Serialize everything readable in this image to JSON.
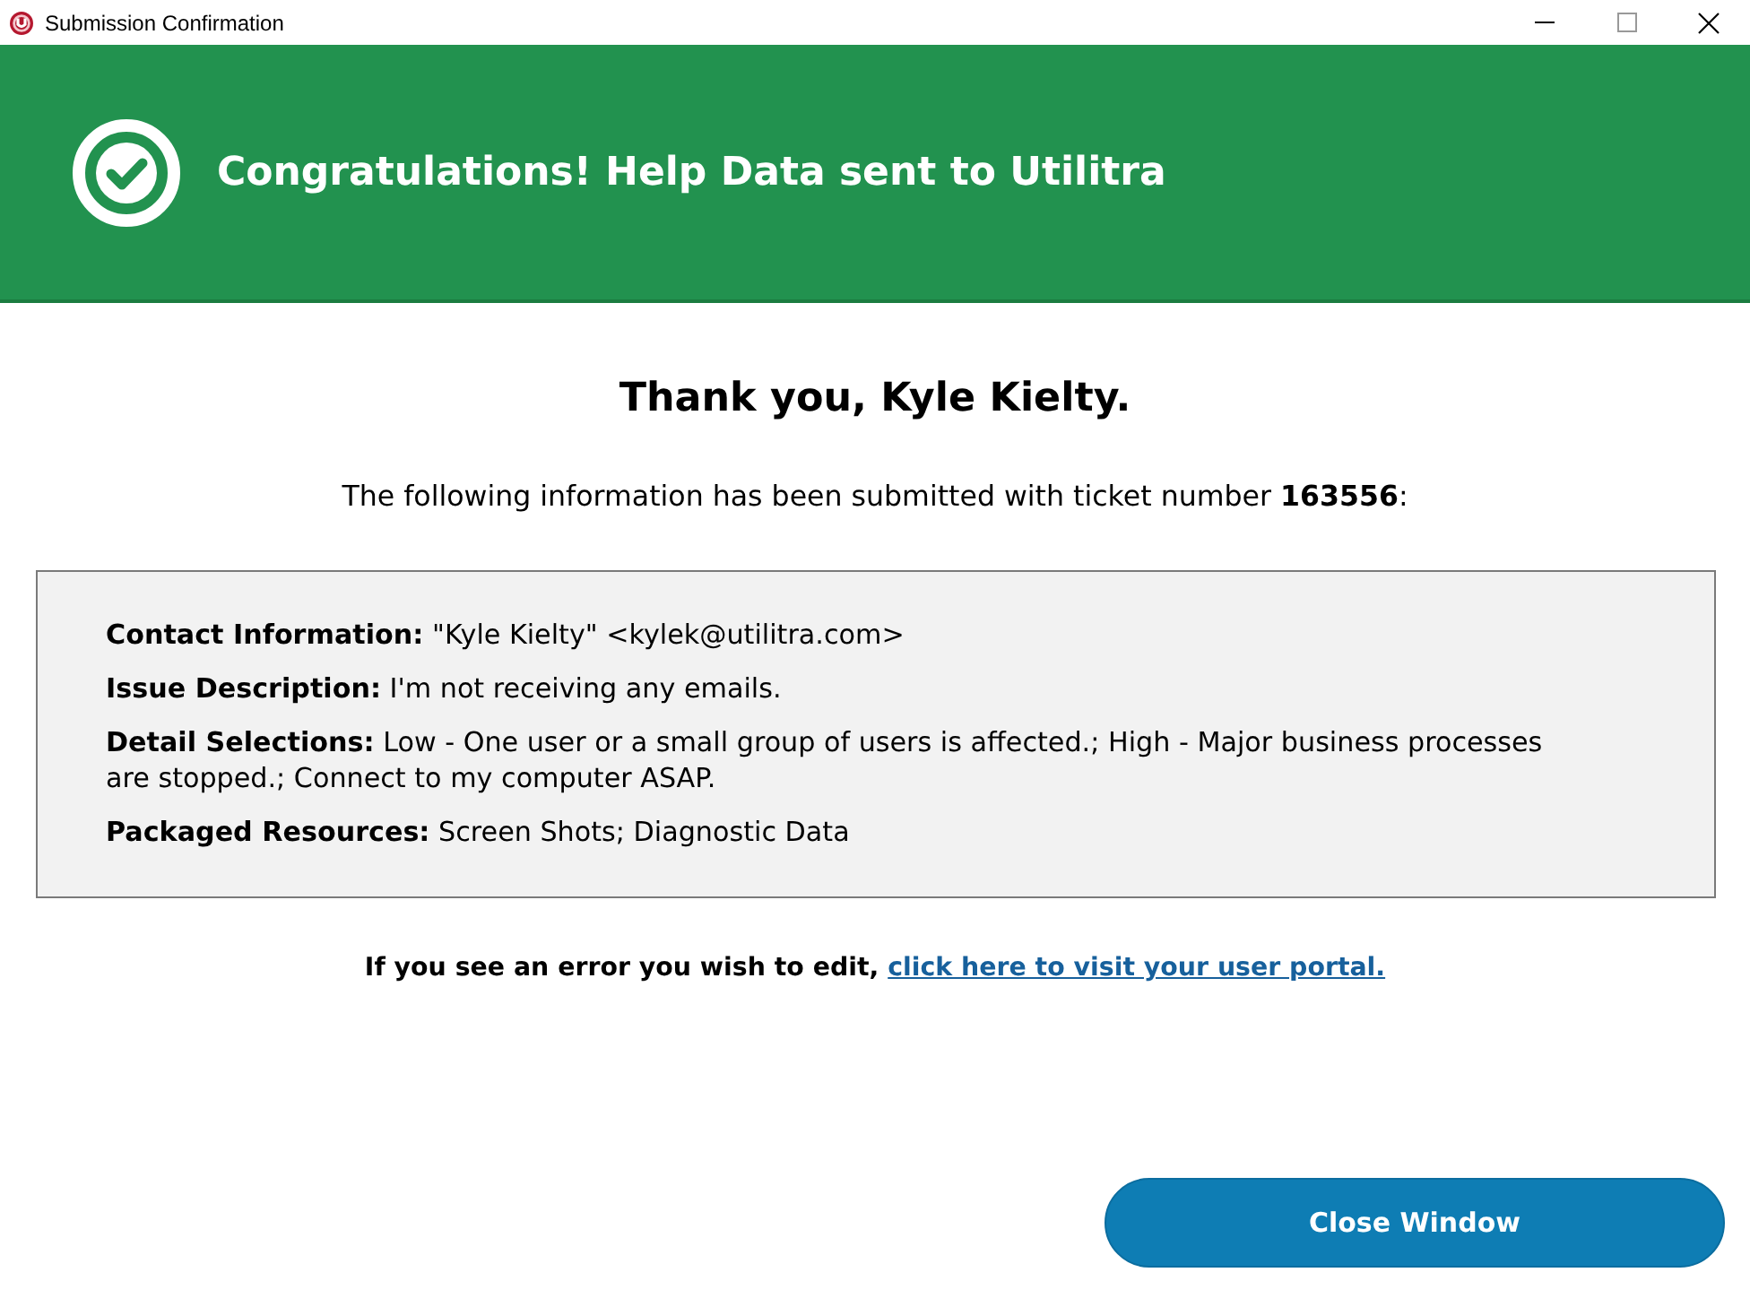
{
  "window": {
    "title": "Submission Confirmation"
  },
  "banner": {
    "title": "Congratulations! Help Data sent to Utilitra"
  },
  "heading": "Thank you, Kyle Kielty.",
  "intro": "The following information has been submitted with ticket number **163556**:",
  "details": [
    "**Contact Information:** \"Kyle Kielty\" <kylek@utilitra.com>",
    "**Issue Description:** I'm not receiving any emails.",
    "**Detail Selections:** Low - One user or a small group of users is affected.; High - Major business processes are stopped.; Connect to my computer ASAP.",
    "**Packaged Resources:** Screen Shots; Diagnostic Data"
  ],
  "edit_prompt": {
    "text": "If you see an error you wish to edit,",
    "link": "click here to visit your user portal."
  },
  "buttons": [
    "Close Window"
  ]
}
